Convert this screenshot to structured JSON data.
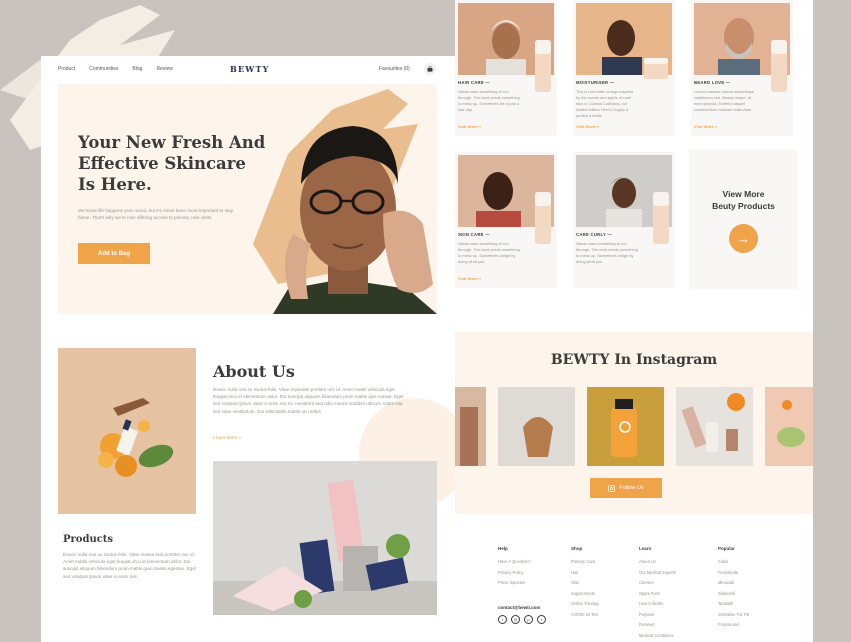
{
  "nav": {
    "links": [
      "Product",
      "Communities",
      "Blog",
      "Review"
    ],
    "logo": "BEWTY",
    "favourites": "Favourites (0)"
  },
  "hero": {
    "title": "Your New Fresh And Effective Skincare Is Here.",
    "subtitle": "We know life happens year round, but it's never been more important to stay home. That's why we're now offering access to primary care visits.",
    "cta": "Add to Bag"
  },
  "about": {
    "title": "About Us",
    "text": "Donec nulla non ex mictus felis. Vitae imperdiet porttitor nec id. Amet mattis vehicula eget feugiat arcu id elementum dolor. Dui suscipit aliquam bibendum proin mattis quis massa. Eget sed volutpat ipsum vitae in enim nisi mi. Hendrerit sed odio mauris sodales ultrices. Diam vita sed vitae vestibulum. Dui sollicitudin mattis orci tellus.",
    "more": "Learn More »"
  },
  "products": {
    "title": "Products",
    "text": "Donec nulla non ex mictus felis. Vitae massa erat porttitor nec id. Amet mattis vehicula eget feugiat arcu id elementum dolor. Dui suscipit aliquam bibendum proin mattis quis massa egestas. Eget sed volutpat ipsum vitae in enim nisi."
  },
  "cards": [
    {
      "label": "HAIR CARE —",
      "desc": "Hands want something to run through. The wind needs something to mess up. Sometimes life is just a hair day.",
      "more": "Visit Store »"
    },
    {
      "label": "MOISTURISER —",
      "desc": "This is how bitter orange inspired by the scents and sights of road trips in Coastal California, our limited edition Hero's Supply a perfect a bottle.",
      "more": "Visit Store »"
    },
    {
      "label": "BEARD LOVE —",
      "desc": "Lectus posuere viverra scelerisque vestibulum sed. Massa neque, at enim gravida. Eleifend aliquet condimentum habitant nulla vitae.",
      "more": "Visit Store »"
    },
    {
      "label": "SKIN CARE —",
      "desc": "Hands want something to run through. The wind needs something to mess up. Sometimes oblige by doing what you.",
      "more": "Visit Store »"
    },
    {
      "label": "CARE CURLY —",
      "desc": "Hands want something to run through. The wind needs something to mess up. Sometimes oblige by doing what you.",
      "more": "Visit Store »"
    }
  ],
  "view_more": {
    "line1": "View More",
    "line2": "Beuty Products",
    "arrow": "→"
  },
  "instagram": {
    "title": "BEWTY In Instagram",
    "follow": "Follow Us"
  },
  "footer": {
    "columns": [
      {
        "heading": "Help",
        "items": [
          "Have A Question?",
          "Privacy Policy",
          "Press Inquiries"
        ]
      },
      {
        "heading": "Shop",
        "items": [
          "Primary Care",
          "Hair",
          "Skin",
          "Supplements",
          "Online Therapy",
          "COVID-19 Test"
        ]
      },
      {
        "heading": "Learn",
        "items": [
          "About Us",
          "Our Medical Experts",
          "Careers",
          "Spark Form",
          "How It Works",
          "Purpose",
          "Reviews",
          "Medical Conditions"
        ]
      },
      {
        "heading": "Popular",
        "items": [
          "Cialis",
          "Finasteride",
          "Minoxidil",
          "Sildenafil",
          "Tadalafil",
          "Sertraline For PE",
          "Propranolol"
        ]
      }
    ],
    "contact": "contact@bewti.com"
  },
  "colors": {
    "accent": "#f0a44a",
    "cream": "#fdf4ec",
    "ink": "#3c3a3a"
  }
}
